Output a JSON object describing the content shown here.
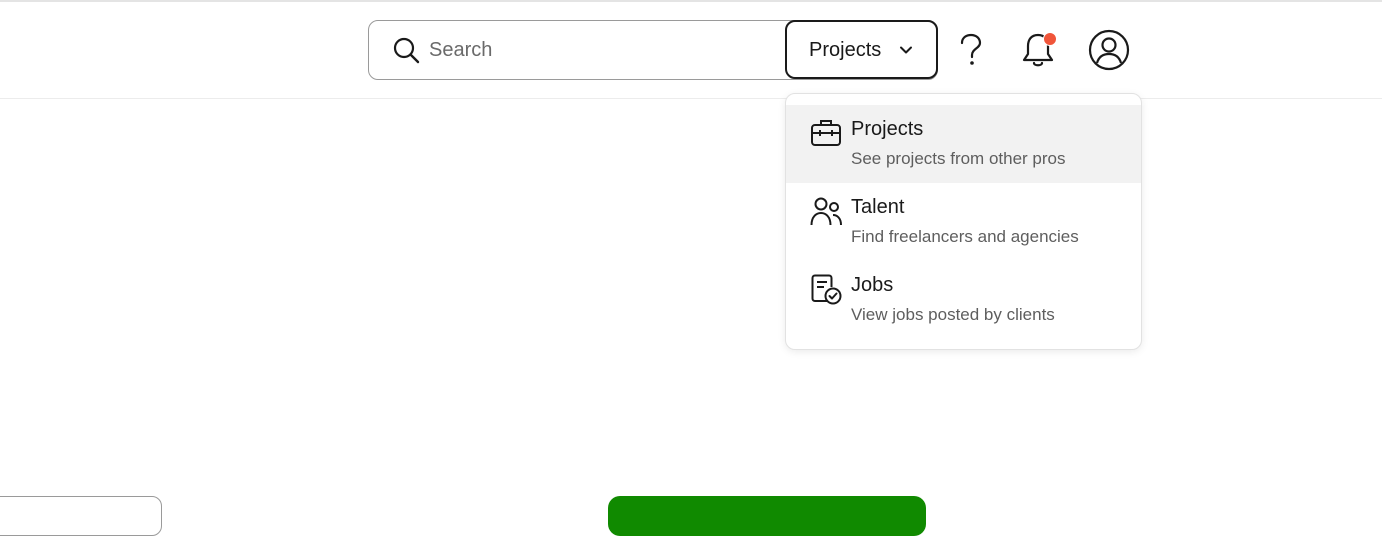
{
  "search": {
    "placeholder": "Search",
    "value": ""
  },
  "scope_select": {
    "label": "Projects"
  },
  "header_icons": {
    "help": "help-icon",
    "notifications": "bell-icon",
    "has_notification": true,
    "account": "avatar-icon"
  },
  "dropdown": {
    "items": [
      {
        "title": "Projects",
        "description": "See projects from other pros",
        "icon": "briefcase-icon",
        "active": true
      },
      {
        "title": "Talent",
        "description": "Find freelancers and agencies",
        "icon": "people-icon",
        "active": false
      },
      {
        "title": "Jobs",
        "description": "View jobs posted by clients",
        "icon": "job-check-icon",
        "active": false
      }
    ]
  },
  "colors": {
    "text": "#1a1a1a",
    "muted": "#5e5e5e",
    "notification_dot": "#f0553a",
    "active_item_bg": "#f2f2f2",
    "brand_green": "#108a00"
  }
}
